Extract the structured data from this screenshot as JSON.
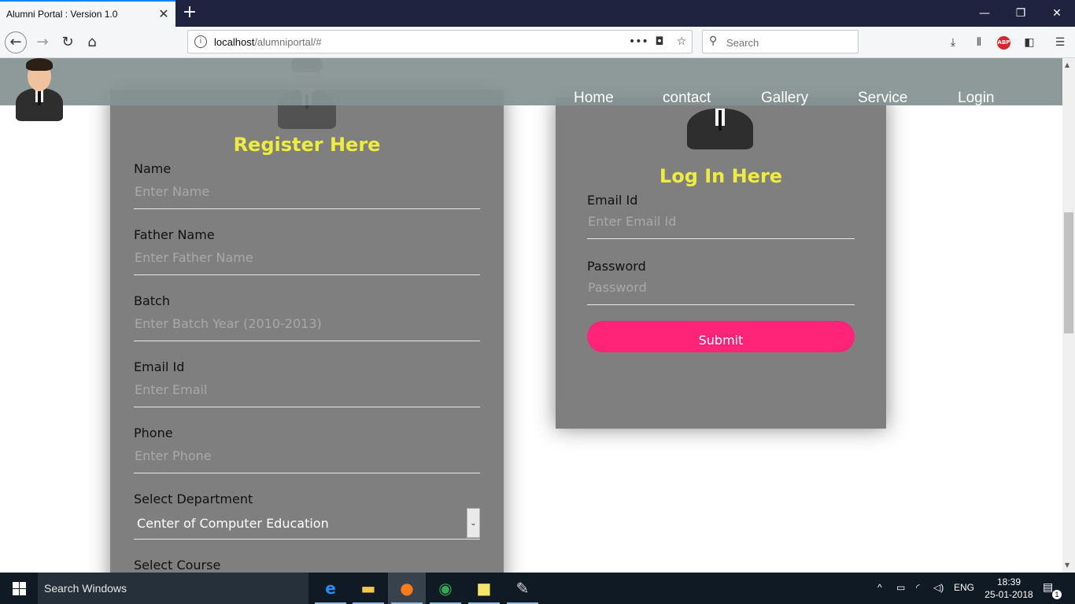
{
  "browser": {
    "tab_title": "Alumni Portal : Version 1.0",
    "tab_close": "✕",
    "new_tab": "+",
    "url_host": "localhost",
    "url_path": "/alumniportal/#",
    "search_placeholder": "Search",
    "abp_label": "ABP"
  },
  "site": {
    "nav": [
      "Home",
      "contact",
      "Gallery",
      "Service",
      "Login"
    ]
  },
  "register": {
    "title": "Register Here",
    "fields": [
      {
        "label": "Name",
        "placeholder": "Enter Name"
      },
      {
        "label": "Father Name",
        "placeholder": "Enter Father Name"
      },
      {
        "label": "Batch",
        "placeholder": "Enter Batch Year (2010-2013)"
      },
      {
        "label": "Email Id",
        "placeholder": "Enter Email"
      },
      {
        "label": "Phone",
        "placeholder": "Enter Phone"
      }
    ],
    "department_label": "Select Department",
    "department_value": "Center of Computer Education",
    "course_label": "Select Course"
  },
  "login": {
    "title": "Log In Here",
    "email_label": "Email Id",
    "email_placeholder": "Enter Email Id",
    "password_label": "Password",
    "password_placeholder": "Password",
    "submit_label": "Submit"
  },
  "taskbar": {
    "search_text": "Search Windows",
    "language": "ENG",
    "time": "18:39",
    "date": "25-01-2018",
    "notification_count": "1"
  }
}
